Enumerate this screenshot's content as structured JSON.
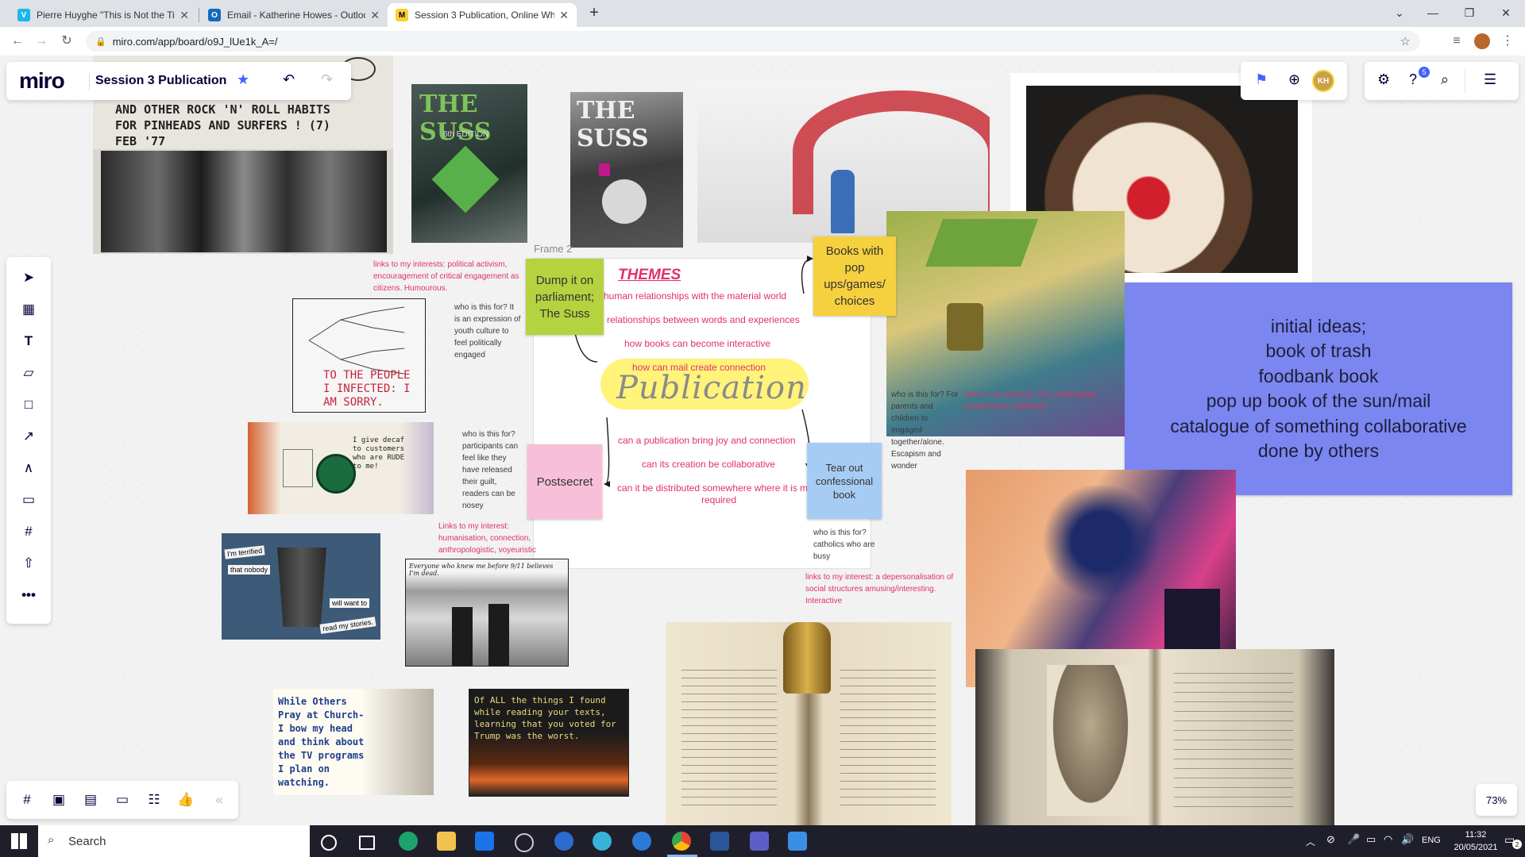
{
  "browser": {
    "tabs": [
      {
        "title": "Pierre Huyghe \"This is Not the Ti",
        "favicon": "V",
        "color": "#1ab7ea"
      },
      {
        "title": "Email - Katherine Howes - Outloo",
        "favicon": "O",
        "color": "#0f6cbd"
      },
      {
        "title": "Session 3 Publication, Online Wh",
        "favicon": "M",
        "color": "#ffd02f"
      }
    ],
    "url": "miro.com/app/board/o9J_lUe1k_A=/"
  },
  "miro": {
    "logo": "miro",
    "board_title": "Session 3 Publication",
    "notification_count": "5",
    "avatar": "KH",
    "zoom": "73%"
  },
  "board": {
    "frame_label": "Frame 2",
    "themes_title": "THEMES",
    "themes": [
      "human relationships with the material world",
      "the relationships between words and experiences",
      "how books can become interactive",
      "how can mail create connection"
    ],
    "center_word": "Publication",
    "questions": [
      "can a publication bring joy and connection",
      "can its creation be collaborative",
      "can it be distributed somewhere where it is most required"
    ],
    "stickies": {
      "dump": "Dump it on parliament; The Suss",
      "books": "Books with pop ups/games/ choices",
      "postsecret": "Postsecret",
      "tearout": "Tear out confessional book"
    },
    "ideas": [
      "initial ideas;",
      "book of trash",
      "foodbank book",
      "pop up book of the sun/mail",
      "catalogue of something collaborative",
      "done by others"
    ],
    "annotations": {
      "interest1": "links to my interests: political activism, encouragement of critical engagement as citizens. Humourous.",
      "who1": "who is this for? It is an expression of youth culture to feel politically engaged",
      "who2": "who is this for? participants can feel like they have released their guilt, readers can be nosey",
      "interest2": "Links to my interest: humanisation, connection, anthropologistic, voyeuristic",
      "who3": "who is this for? For parents and children to engaged together/alone. Escapism and wonder",
      "interest3": "links to my interests; fun, challenging, motherhood, childhood.",
      "who4": "who is this for? catholics who are busy",
      "interest4": "links to my interest: a depersonalisation of social structures amusing/interesting. Interactive"
    },
    "image_text": {
      "zine_header": "AND OTHER ROCK 'N' ROLL HABITS FOR PINHEADS AND SURFERS ! (7) FEB '77",
      "suss1": "THE SUSS",
      "suss1_edition": "6th EDITION",
      "suss2": "THE SUSS",
      "sorry": "TO THE PEOPLE I INFECTED: I AM SORRY.",
      "cup": "I give decaf to customers who are RUDE to me!",
      "bin1": "I'm terrified",
      "bin2": "that nobody",
      "bin3": "will want to",
      "bin4": "read my stories.",
      "twin": "Everyone who knew me before 9/11 believes I'm dead.",
      "church": "While Others Pray at Church- I bow my head and think about the TV programs I plan on watching.",
      "trump": "Of ALL the things I found while reading your texts, learning that you voted for Trump was the worst."
    }
  },
  "taskbar": {
    "search": "Search",
    "lang": "ENG",
    "time": "11:32",
    "date": "20/05/2021",
    "badge": "2"
  }
}
